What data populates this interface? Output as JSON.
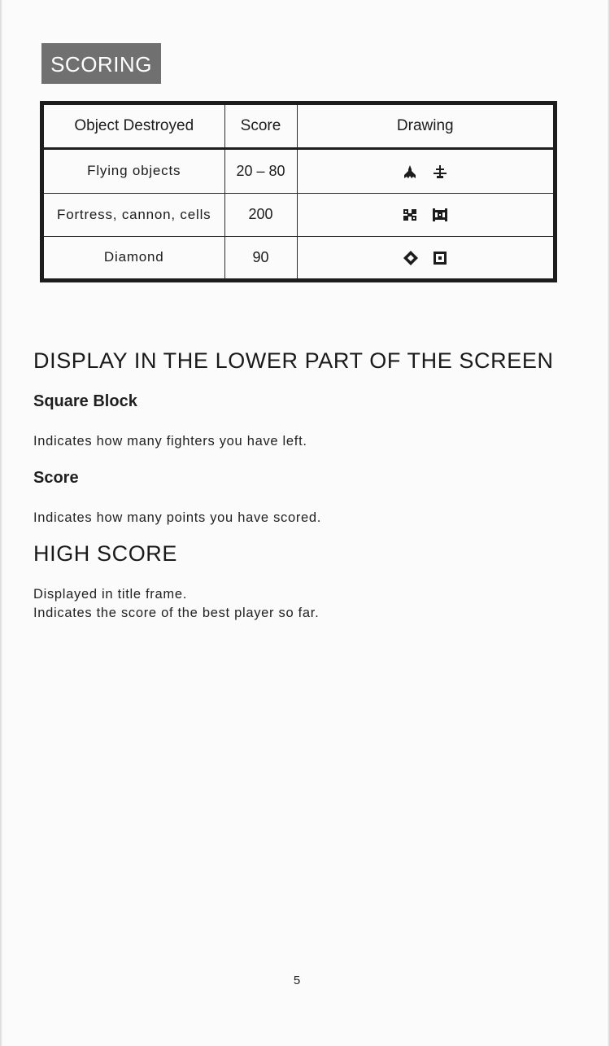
{
  "banner": {
    "title": "SCORING"
  },
  "table": {
    "headers": [
      "Object Destroyed",
      "Score",
      "Drawing"
    ],
    "rows": [
      {
        "object": "Flying objects",
        "score": "20 – 80",
        "icons": [
          "fighter-ship-icon",
          "flying-saucer-icon"
        ]
      },
      {
        "object": "Fortress, cannon, cells",
        "score": "200",
        "icons": [
          "fortress-icon",
          "cannon-icon"
        ]
      },
      {
        "object": "Diamond",
        "score": "90",
        "icons": [
          "diamond-icon",
          "square-block-icon"
        ]
      }
    ]
  },
  "display": {
    "heading": "DISPLAY IN THE LOWER PART OF THE SCREEN",
    "square_block": {
      "title": "Square Block",
      "text": "Indicates how many fighters you have left."
    },
    "score": {
      "title": "Score",
      "text": "Indicates how many points you have scored."
    }
  },
  "high_score": {
    "heading": "HIGH SCORE",
    "line1": "Displayed in title frame.",
    "line2": "Indicates the score of the best player so far."
  },
  "page_number": "5",
  "colors": {
    "banner_bg": "#707070",
    "ink": "#1c1c1c",
    "paper": "#fbfbfb"
  }
}
